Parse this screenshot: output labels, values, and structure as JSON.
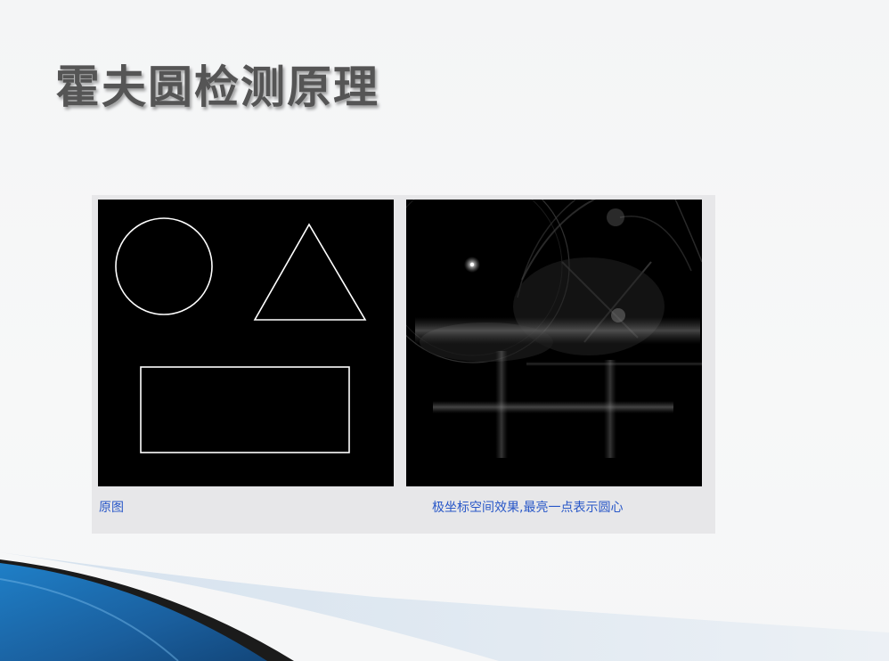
{
  "slide": {
    "title": "霍夫圆检测原理"
  },
  "figure": {
    "left_caption": "原图",
    "right_caption": "极坐标空间效果,最亮一点表示圆心",
    "left_shapes": [
      "circle",
      "triangle",
      "rectangle"
    ]
  },
  "colors": {
    "title": "#555555",
    "caption": "#2857c8",
    "panel_bg": "#000000",
    "shape_stroke": "#ffffff",
    "wave_blue": "#1a5f9e"
  }
}
